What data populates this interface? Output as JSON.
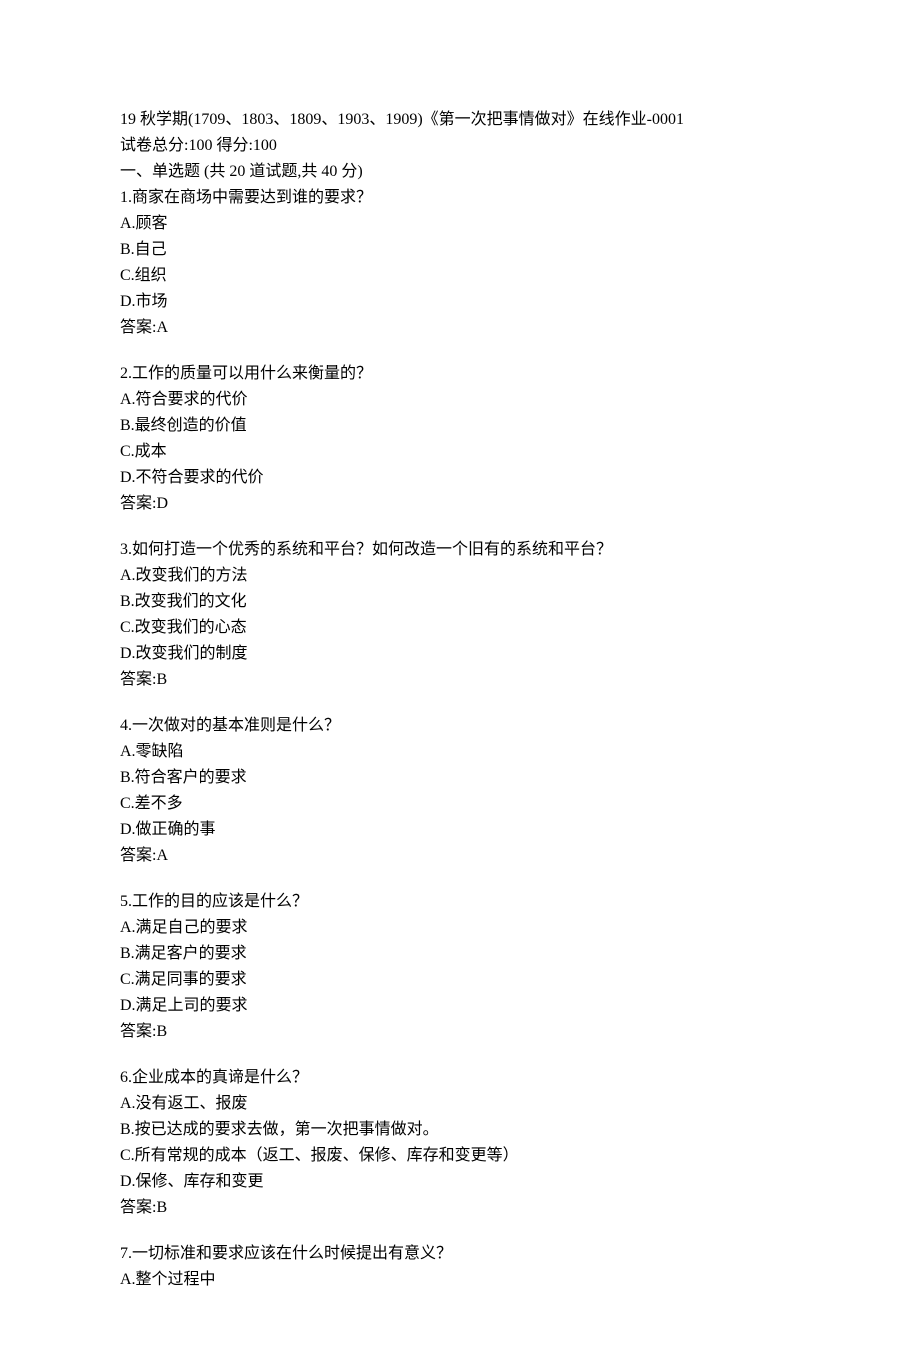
{
  "header": {
    "title": "19 秋学期(1709、1803、1809、1903、1909)《第一次把事情做对》在线作业-0001",
    "score_line": "试卷总分:100  得分:100"
  },
  "section": {
    "heading": "一、单选题 (共 20 道试题,共 40 分)"
  },
  "questions": [
    {
      "q": "1.商家在商场中需要达到谁的要求？",
      "opts": [
        "A.顾客",
        "B.自己",
        "C.组织",
        "D.市场"
      ],
      "answer": "答案:A"
    },
    {
      "q": "2.工作的质量可以用什么来衡量的？",
      "opts": [
        "A.符合要求的代价",
        "B.最终创造的价值",
        "C.成本",
        "D.不符合要求的代价"
      ],
      "answer": "答案:D"
    },
    {
      "q": "3.如何打造一个优秀的系统和平台？如何改造一个旧有的系统和平台？",
      "opts": [
        "A.改变我们的方法",
        "B.改变我们的文化",
        "C.改变我们的心态",
        "D.改变我们的制度"
      ],
      "answer": "答案:B"
    },
    {
      "q": "4.一次做对的基本准则是什么？",
      "opts": [
        "A.零缺陷",
        "B.符合客户的要求",
        "C.差不多",
        "D.做正确的事"
      ],
      "answer": "答案:A"
    },
    {
      "q": "5.工作的目的应该是什么？",
      "opts": [
        "A.满足自己的要求",
        "B.满足客户的要求",
        "C.满足同事的要求",
        "D.满足上司的要求"
      ],
      "answer": "答案:B"
    },
    {
      "q": "6.企业成本的真谛是什么？",
      "opts": [
        "A.没有返工、报废",
        "B.按已达成的要求去做，第一次把事情做对。",
        "C.所有常规的成本（返工、报废、保修、库存和变更等）",
        "D.保修、库存和变更"
      ],
      "answer": "答案:B"
    },
    {
      "q": "7.一切标准和要求应该在什么时候提出有意义？",
      "opts": [
        "A.整个过程中"
      ],
      "answer": ""
    }
  ]
}
